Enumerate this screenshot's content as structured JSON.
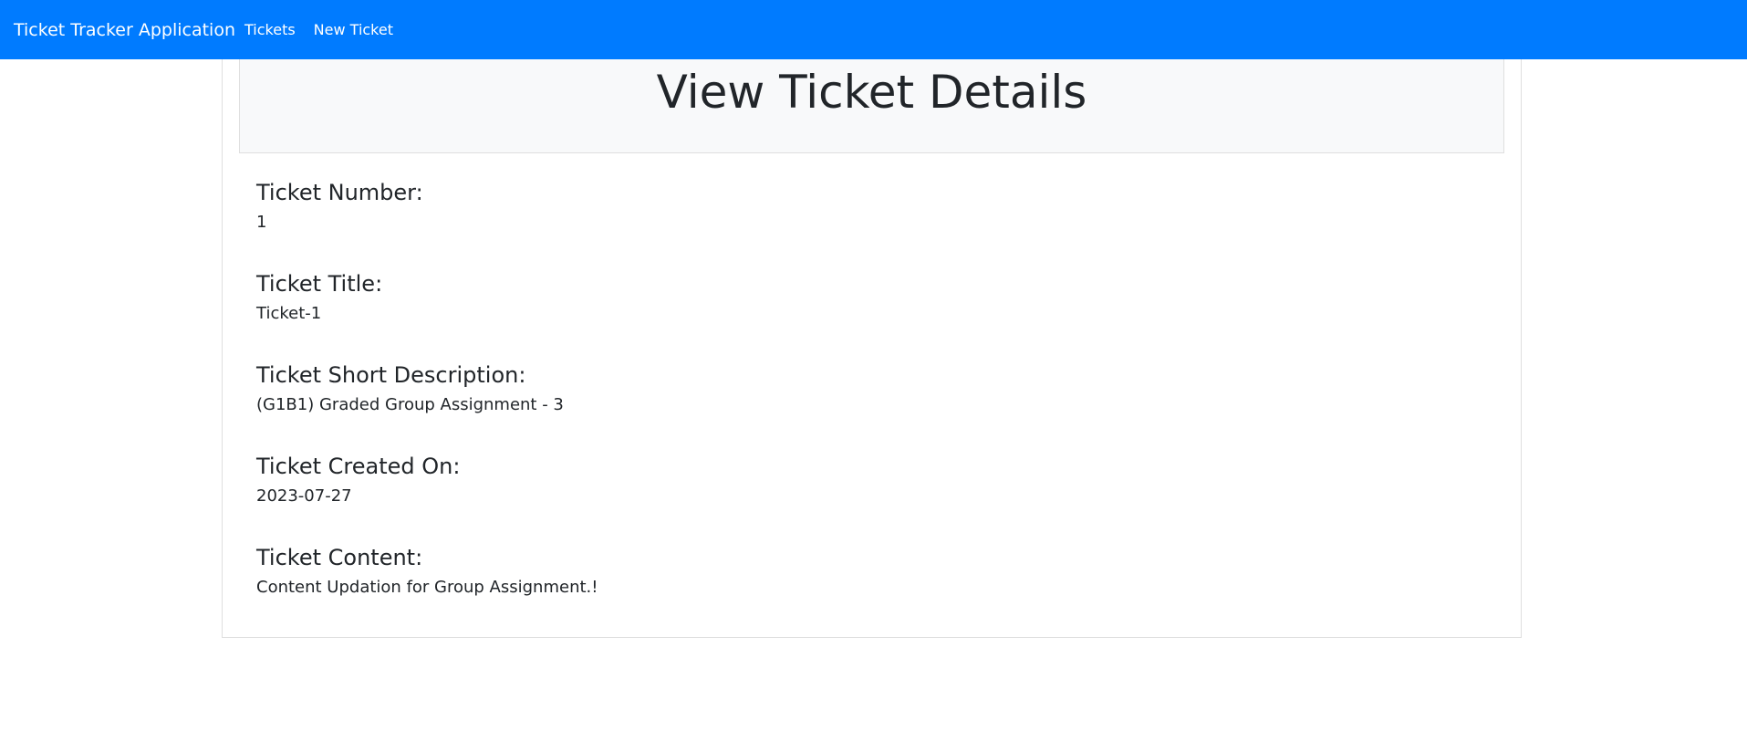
{
  "navbar": {
    "brand": "Ticket Tracker Application",
    "links": [
      "Tickets",
      "New Ticket"
    ],
    "color": "#007bff"
  },
  "page": {
    "title": "View Ticket Details"
  },
  "fields": [
    {
      "label": "Ticket Number:",
      "value": "1"
    },
    {
      "label": "Ticket Title:",
      "value": "Ticket-1"
    },
    {
      "label": "Ticket Short Description:",
      "value": "(G1B1) Graded Group Assignment - 3"
    },
    {
      "label": "Ticket Created On:",
      "value": "2023-07-27"
    },
    {
      "label": "Ticket Content:",
      "value": "Content Updation for Group Assignment.!"
    }
  ]
}
